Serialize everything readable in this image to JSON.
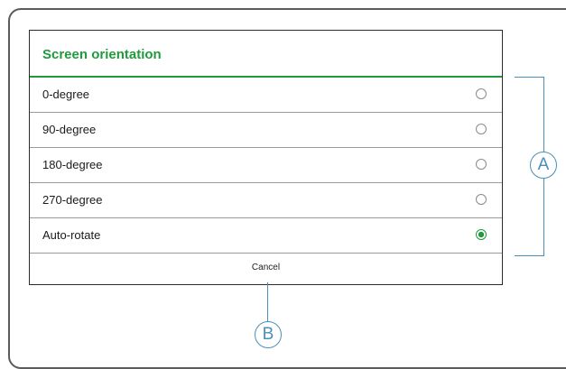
{
  "dialog": {
    "title": "Screen orientation",
    "options": [
      {
        "label": "0-degree",
        "selected": false
      },
      {
        "label": "90-degree",
        "selected": false
      },
      {
        "label": "180-degree",
        "selected": false
      },
      {
        "label": "270-degree",
        "selected": false
      },
      {
        "label": "Auto-rotate",
        "selected": true
      }
    ],
    "cancel_label": "Cancel"
  },
  "callouts": {
    "a": "A",
    "b": "B"
  },
  "colors": {
    "accent": "#1f9a3c",
    "callout": "#4a8fb8"
  }
}
